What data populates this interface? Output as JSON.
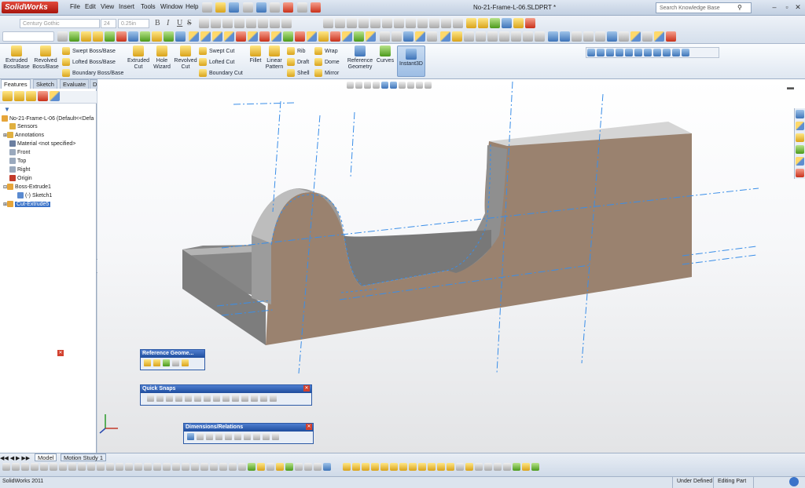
{
  "app": {
    "logo": "SolidWorks",
    "document_title": "No-21-Frame-L-06.SLDPRT *"
  },
  "menu": [
    "File",
    "Edit",
    "View",
    "Insert",
    "Tools",
    "Window",
    "Help"
  ],
  "search": {
    "placeholder": "Search Knowledge Base"
  },
  "font_toolbar": {
    "font": "Century Gothic",
    "size": "24",
    "height": "0.25in",
    "bold": "B",
    "italic": "I",
    "underline": "U",
    "strike": "S"
  },
  "command_manager": {
    "extruded_boss": "Extruded Boss/Base",
    "revolved_boss": "Revolved Boss/Base",
    "swept_boss": "Swept Boss/Base",
    "lofted_boss": "Lofted Boss/Base",
    "boundary_boss": "Boundary Boss/Base",
    "extruded_cut": "Extruded Cut",
    "hole_wizard": "Hole Wizard",
    "revolved_cut": "Revolved Cut",
    "swept_cut": "Swept Cut",
    "lofted_cut": "Lofted Cut",
    "boundary_cut": "Boundary Cut",
    "fillet": "Fillet",
    "linear_pattern": "Linear Pattern",
    "rib": "Rib",
    "draft": "Draft",
    "shell": "Shell",
    "wrap": "Wrap",
    "dome": "Dome",
    "mirror": "Mirror",
    "reference_geometry": "Reference Geometry",
    "curves": "Curves",
    "instant3d": "Instant3D"
  },
  "tabs": [
    "Features",
    "Sketch",
    "Evaluate",
    "DimXpert"
  ],
  "feature_tree": [
    {
      "label": "No-21-Frame-L-06 (Default<<Defa",
      "color": "#e6a53a"
    },
    {
      "label": "Sensors",
      "color": "#e0b040"
    },
    {
      "label": "Annotations",
      "color": "#e0b040"
    },
    {
      "label": "Material <not specified>",
      "color": "#6a7ea0"
    },
    {
      "label": "Front",
      "color": "#9aa9bd"
    },
    {
      "label": "Top",
      "color": "#9aa9bd"
    },
    {
      "label": "Right",
      "color": "#9aa9bd"
    },
    {
      "label": "Origin",
      "color": "#c23a2a"
    },
    {
      "label": "Boss-Extrude1",
      "color": "#e6a53a"
    },
    {
      "label": "(-) Sketch1",
      "color": "#5a8ad0"
    },
    {
      "label": "Cut-Extrude5",
      "color": "#e6a53a"
    }
  ],
  "floating": {
    "reference_geometry": "Reference Geome...",
    "quick_snaps": "Quick Snaps",
    "dimensions_relations": "Dimensions/Relations"
  },
  "bottom_tabs": [
    "Model",
    "Motion Study 1"
  ],
  "status": {
    "app": "SolidWorks 2011",
    "under_defined": "Under Defined",
    "editing": "Editing Part"
  },
  "colors": {
    "part_face": "#9a826f",
    "part_grey": "#8d8d8d",
    "sketch_line": "#3a8ee8",
    "selection": "#2d5aa6"
  }
}
